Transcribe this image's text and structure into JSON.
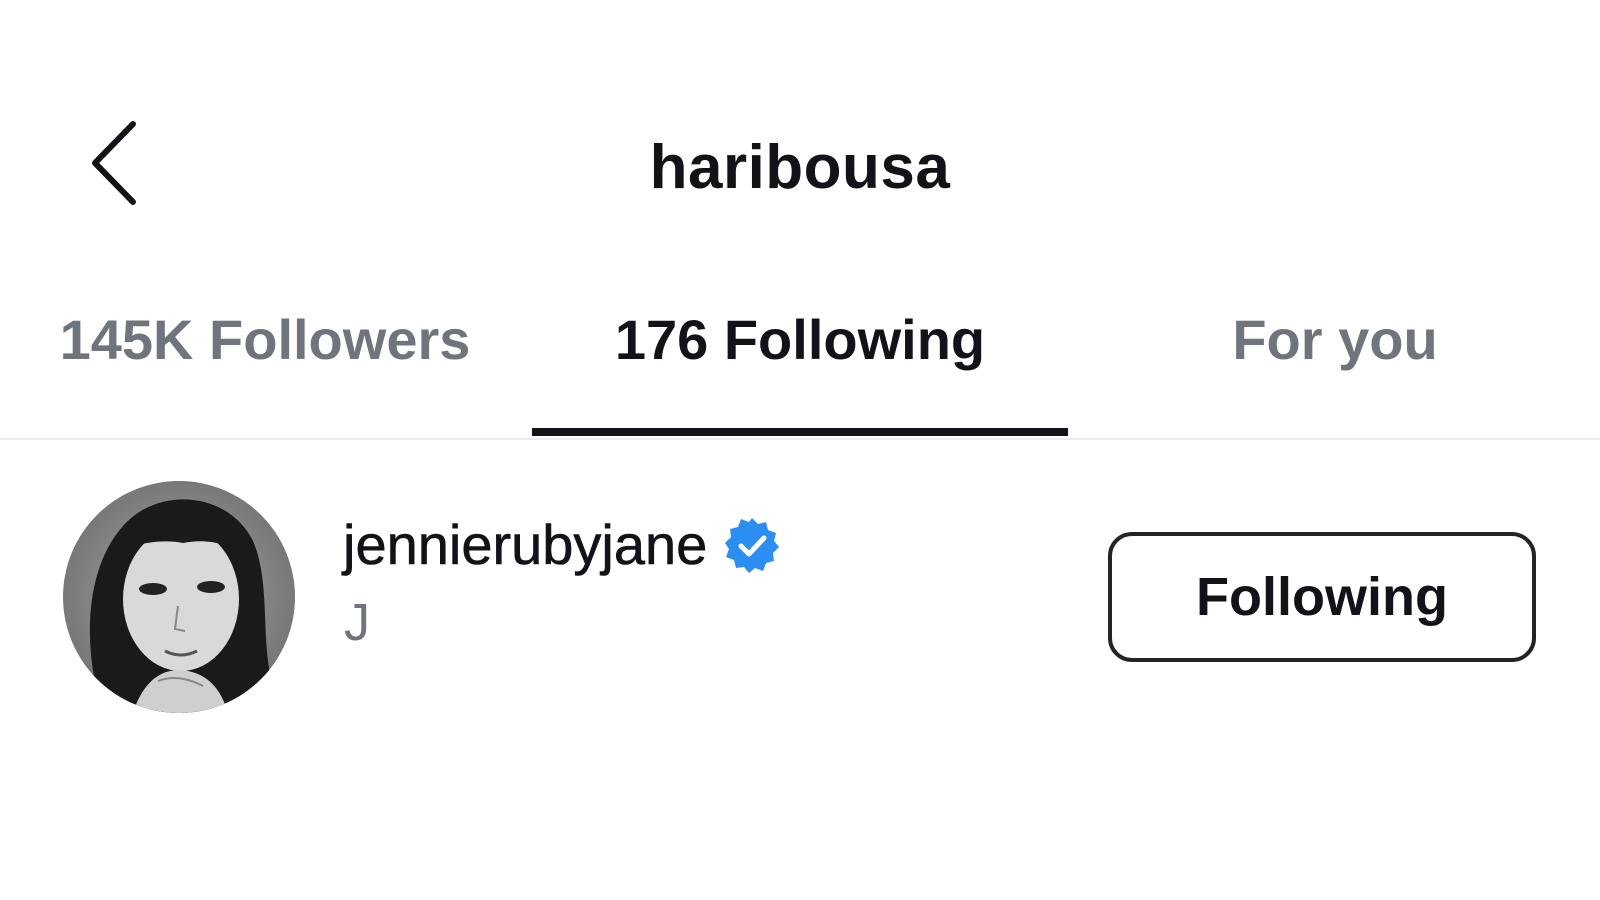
{
  "header": {
    "title": "haribousa",
    "back_icon": "chevron-left-icon"
  },
  "tabs": [
    {
      "label": "145K Followers",
      "active": false
    },
    {
      "label": "176 Following",
      "active": true
    },
    {
      "label": "For you",
      "active": false
    }
  ],
  "list": {
    "items": [
      {
        "username": "jennierubyjane",
        "verified": true,
        "verified_icon": "verified-badge-icon",
        "full_name": "J",
        "action_label": "Following",
        "avatar_icon": "avatar-photo"
      }
    ]
  },
  "colors": {
    "text_primary": "#111318",
    "text_secondary": "#70747d",
    "verified_blue": "#2b8ef0",
    "divider": "#ececec"
  }
}
